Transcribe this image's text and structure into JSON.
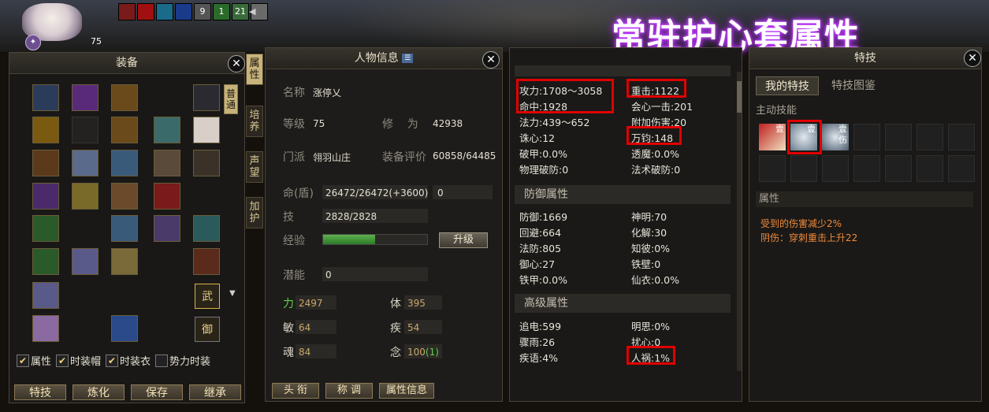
{
  "hud": {
    "level": "75",
    "avatar_badge": "✦",
    "buff_numbers": [
      "9",
      "1",
      "21"
    ]
  },
  "headline": "常驻护心套属性",
  "equipment": {
    "title": "装备",
    "side_tab": [
      "普",
      "通"
    ],
    "wu_label": "武",
    "yu_label": "御",
    "checkboxes": [
      {
        "label": "属性",
        "checked": true
      },
      {
        "label": "时装帽",
        "checked": true
      },
      {
        "label": "时装衣",
        "checked": true
      },
      {
        "label": "势力时装",
        "checked": false
      }
    ],
    "buttons": [
      "特技",
      "炼化",
      "保存",
      "继承"
    ]
  },
  "side_tabs": [
    {
      "label": [
        "属",
        "性"
      ],
      "active": true
    },
    {
      "label": [
        "培",
        "养"
      ],
      "active": false
    },
    {
      "label": [
        "声",
        "望"
      ],
      "active": false
    },
    {
      "label": [
        "加",
        "护"
      ],
      "active": false
    }
  ],
  "char_info": {
    "title": "人物信息",
    "name_label": "名称",
    "name": "涨停乂",
    "level_label": "等级",
    "level": "75",
    "cultivation_label": "修    为",
    "cultivation": "42938",
    "school_label": "门派",
    "school": "翎羽山庄",
    "rating_label": "装备评价",
    "rating": "60858/64485",
    "hp_label": "命(盾)",
    "hp": "26472/26472(+3600)",
    "shield": "0",
    "skill_label": "技",
    "skill": "2828/2828",
    "exp_label": "经验",
    "exp_progress": 0.5,
    "upgrade": "升级",
    "potential_label": "潜能",
    "potential": "0",
    "attrs": [
      {
        "label": "力",
        "value": "2497"
      },
      {
        "label": "体",
        "value": "395"
      },
      {
        "label": "敏",
        "value": "64"
      },
      {
        "label": "疾",
        "value": "54"
      },
      {
        "label": "魂",
        "value": "84"
      },
      {
        "label": "念",
        "value": "100",
        "bonus": "(1)"
      }
    ],
    "bottom_buttons": [
      "头 衔",
      "称 调",
      "属性信息"
    ]
  },
  "stats": {
    "top_rows": [
      [
        "攻力:1708～3058",
        "重击:1122"
      ],
      [
        "命中:1928",
        "会心一击:201"
      ],
      [
        "法力:439～652",
        "附加伤害:20"
      ],
      [
        "诛心:12",
        "万钧:148"
      ],
      [
        "破甲:0.0%",
        "透魔:0.0%"
      ],
      [
        "物理破防:0",
        "法术破防:0"
      ]
    ],
    "defense_title": "防御属性",
    "defense_rows": [
      [
        "防御:1669",
        "神明:70"
      ],
      [
        "回避:664",
        "化解:30"
      ],
      [
        "法防:805",
        "知彼:0%"
      ],
      [
        "御心:27",
        "铁壁:0"
      ],
      [
        "铁甲:0.0%",
        "仙衣:0.0%"
      ]
    ],
    "advanced_title": "高级属性",
    "advanced_rows": [
      [
        "追电:599",
        "明思:0%"
      ],
      [
        "骤雨:26",
        "扰心:0"
      ],
      [
        "疾语:4%",
        "人祸:1%"
      ]
    ]
  },
  "skills": {
    "title": "特技",
    "tabs": [
      "我的特技",
      "特技图鉴"
    ],
    "active_label": "主动技能",
    "icon_labels": [
      "壹",
      "壹",
      "壹",
      "伤"
    ],
    "attr_label": "属性",
    "desc": [
      "受到的伤害减少2%",
      "阴伤：穿刺重击上升22"
    ]
  }
}
